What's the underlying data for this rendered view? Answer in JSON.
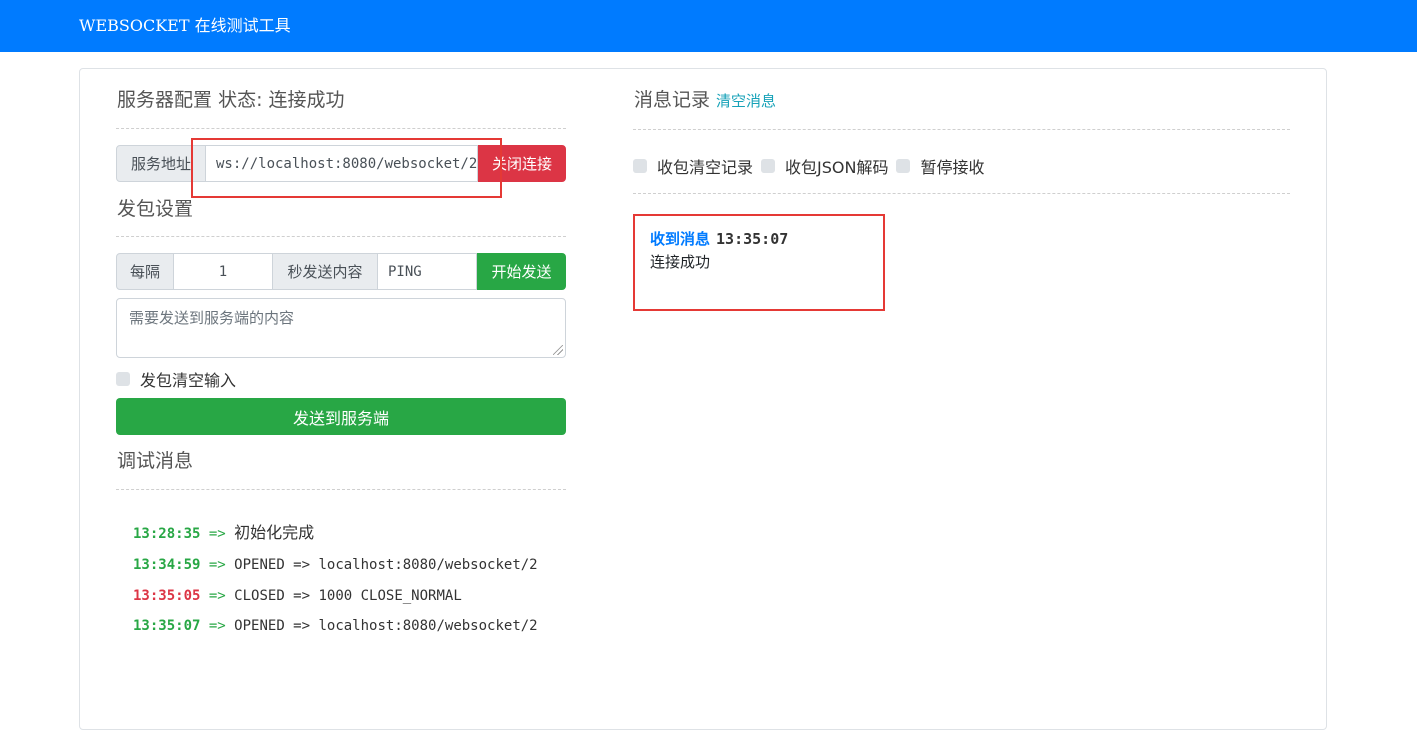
{
  "header": {
    "brand": "WEBSOCKET 在线测试工具",
    "color": "#007bff"
  },
  "server": {
    "title": "服务器配置",
    "status": "状态: 连接成功",
    "address_label": "服务地址",
    "address_value": "ws://localhost:8080/websocket/2",
    "close_button": "关闭连接"
  },
  "send_settings": {
    "title": "发包设置",
    "interval_label": "每隔",
    "interval_value": "1",
    "content_label": "秒发送内容",
    "content_value": "PING",
    "start_button": "开始发送",
    "textarea_placeholder": "需要发送到服务端的内容",
    "clear_input_label": "发包清空输入",
    "send_button": "发送到服务端"
  },
  "debug": {
    "title": "调试消息",
    "entries": [
      {
        "time": "13:28:35",
        "arrow": "=>",
        "text": "初始化完成",
        "status": "ok"
      },
      {
        "time": "13:34:59",
        "arrow": "=>",
        "text": "OPENED => localhost:8080/websocket/2",
        "status": "ok"
      },
      {
        "time": "13:35:05",
        "arrow": "=>",
        "text": "CLOSED => 1000 CLOSE_NORMAL",
        "status": "error"
      },
      {
        "time": "13:35:07",
        "arrow": "=>",
        "text": "OPENED => localhost:8080/websocket/2",
        "status": "ok"
      }
    ]
  },
  "messages": {
    "title": "消息记录",
    "clear_link": "清空消息",
    "options": [
      "收包清空记录",
      "收包JSON解码",
      "暂停接收"
    ],
    "received_label": "收到消息",
    "received_time": "13:35:07",
    "received_text": "连接成功"
  }
}
